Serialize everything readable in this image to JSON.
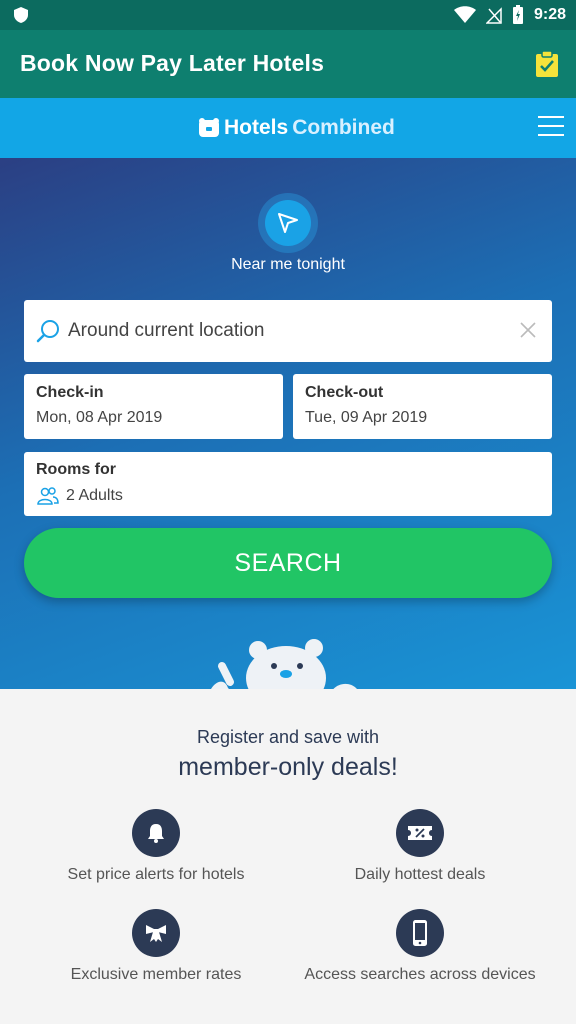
{
  "status_bar": {
    "time": "9:28",
    "icons": [
      "shield-icon",
      "wifi-icon",
      "signal-icon",
      "battery-icon"
    ]
  },
  "app_bar": {
    "title": "Book Now Pay Later Hotels",
    "action_icon": "clipboard-check-icon"
  },
  "brand_bar": {
    "logo_text_1": "Hotels",
    "logo_text_2": "Combined",
    "menu_icon": "hamburger-menu-icon"
  },
  "hero": {
    "near_me_label": "Near me tonight",
    "search": {
      "value": "Around current location",
      "clear_icon": "close-icon"
    },
    "checkin": {
      "label": "Check-in",
      "value": "Mon, 08 Apr 2019"
    },
    "checkout": {
      "label": "Check-out",
      "value": "Tue, 09 Apr 2019"
    },
    "rooms": {
      "label": "Rooms for",
      "value": "2 Adults"
    },
    "search_button": "SEARCH"
  },
  "promo": {
    "subtitle": "Register and save with",
    "headline": "member-only deals!",
    "features": [
      {
        "icon": "bell-icon",
        "text": "Set price alerts for hotels"
      },
      {
        "icon": "discount-ticket-icon",
        "text": "Daily hottest deals"
      },
      {
        "icon": "bow-tie-icon",
        "text": "Exclusive member rates"
      },
      {
        "icon": "smartphone-icon",
        "text": "Access searches across devices"
      }
    ]
  },
  "colors": {
    "app_bar": "#0e7f6f",
    "brand_bar": "#12a6e6",
    "search_button": "#21c565",
    "feature_circle": "#2c3a55"
  }
}
